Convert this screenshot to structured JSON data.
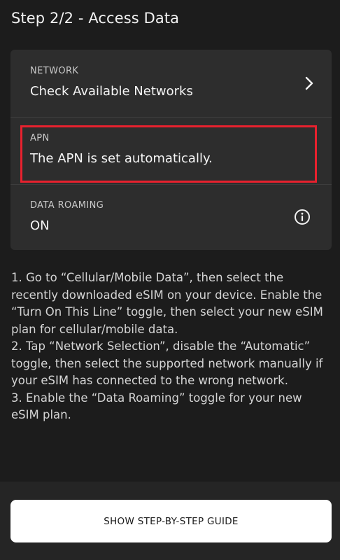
{
  "header": {
    "title": "Step 2/2 - Access Data"
  },
  "settings_card": {
    "network": {
      "label": "NETWORK",
      "value": "Check Available Networks",
      "icon": "chevron-right-icon"
    },
    "apn": {
      "label": "APN",
      "value": "The APN is set automatically.",
      "highlight_color": "#e8212e"
    },
    "data_roaming": {
      "label": "DATA ROAMING",
      "value": "ON",
      "icon": "info-icon"
    }
  },
  "instructions": [
    "1. Go to “Cellular/Mobile Data”, then select the recently downloaded eSIM on your device. Enable the “Turn On This Line” toggle, then select your new eSIM plan for cellular/mobile data.",
    "2. Tap “Network Selection”, disable the “Automatic” toggle, then select the supported network manually if your eSIM has connected to the wrong network.",
    "3. Enable the “Data Roaming” toggle for your new eSIM plan."
  ],
  "footer": {
    "guide_button_label": "SHOW STEP-BY-STEP GUIDE"
  }
}
